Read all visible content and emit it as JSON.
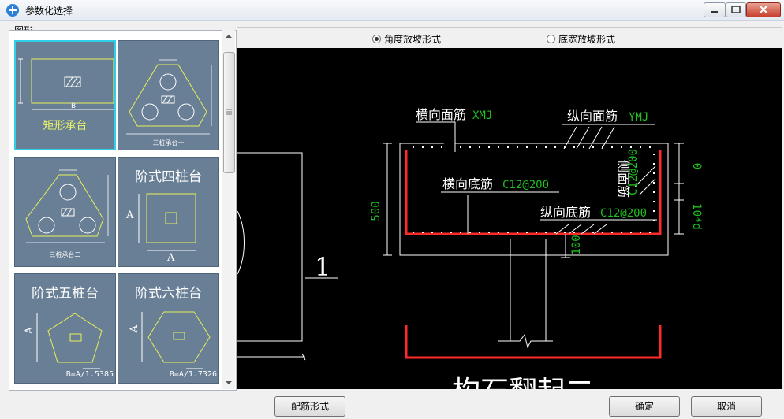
{
  "window": {
    "title": "参数化选择"
  },
  "left": {
    "group_label": "图形",
    "tiles": [
      {
        "label": "矩形承台",
        "dim_b": "B"
      },
      {
        "label": "三桩承台一"
      },
      {
        "label": "三桩承台二"
      },
      {
        "label": "阶式四桩台",
        "dim": "A"
      },
      {
        "label": "阶式五桩台",
        "dim": "A",
        "formula": "B=A/1.5385"
      },
      {
        "label": "阶式六桩台",
        "dim": "A",
        "formula": "B=A/1.7326"
      }
    ]
  },
  "options": {
    "angle_label": "角度放坡形式",
    "width_label": "底宽放坡形式",
    "selected": "angle"
  },
  "drawing": {
    "h_top": "横向面筋",
    "h_top_code": "XMJ",
    "v_top": "纵向面筋",
    "v_top_code": "YMJ",
    "h_bottom": "横向底筋",
    "h_bottom_code": "C12@200",
    "v_bottom": "纵向底筋",
    "v_bottom_code": "C12@200",
    "side": "侧面筋",
    "side_code": "C12@200",
    "dim_500": "500",
    "dim_0": "0",
    "dim_10d": "10*d",
    "dim_100": "100",
    "section_mark": "1",
    "bottom_caption": "构石翻起二"
  },
  "buttons": {
    "rebar_form": "配筋形式",
    "ok": "确定",
    "cancel": "取消"
  },
  "colors": {
    "canvas_bg": "#000000",
    "tile_bg": "#697f96",
    "code_green": "#1fbf1f",
    "rebar_red": "#ff2a2a",
    "selected_border": "#2dd0e6"
  }
}
